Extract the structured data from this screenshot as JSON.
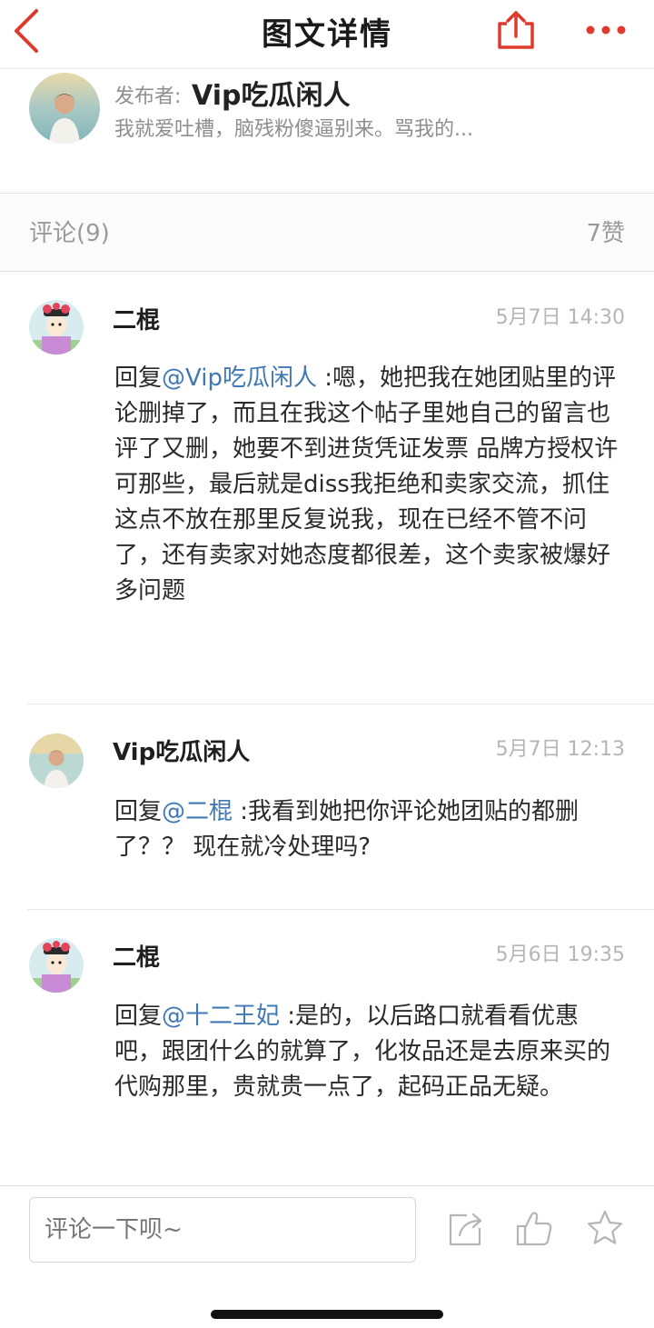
{
  "nav": {
    "title": "图文详情",
    "accent_color": "#e03a2f",
    "back_icon": "chevron-left-icon",
    "share_icon": "share-icon",
    "more_icon": "more-icon"
  },
  "publisher": {
    "label": "发布者:",
    "name": "Vip吃瓜闲人",
    "description": "我就爱吐槽，脑残粉傻逼别来。骂我的..."
  },
  "stats": {
    "comments": "评论(9)",
    "likes": "7赞"
  },
  "comments": [
    {
      "author": "二棍",
      "time": "5月7日 14:30",
      "reply_prefix": "回复",
      "mention": "@Vip吃瓜闲人",
      "text": " :嗯，她把我在她团贴里的评论删掉了，而且在我这个帖子里她自己的留言也评了又删，她要不到进货凭证发票 品牌方授权许可那些，最后就是diss我拒绝和卖家交流，抓住这点不放在那里反复说我，现在已经不管不问了，还有卖家对她态度都很差，这个卖家被爆好多问题"
    },
    {
      "author": "Vip吃瓜闲人",
      "time": "5月7日 12:13",
      "reply_prefix": "回复",
      "mention": "@二棍",
      "text": " :我看到她把你评论她团贴的都删了？？ 现在就冷处理吗?"
    },
    {
      "author": "二棍",
      "time": "5月6日 19:35",
      "reply_prefix": "回复",
      "mention": "@十二王妃",
      "text": " :是的，以后路口就看看优惠吧，跟团什么的就算了，化妆品还是去原来买的代购那里，贵就贵一点了，起码正品无疑。"
    }
  ],
  "bottom": {
    "input_placeholder": "评论一下呗~",
    "icons": [
      "compose-share-icon",
      "thumbs-up-icon",
      "star-icon"
    ]
  }
}
